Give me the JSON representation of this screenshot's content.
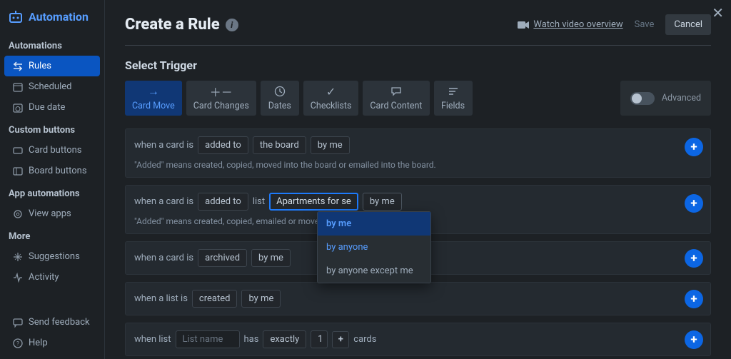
{
  "brand": "Automation",
  "sidebar": {
    "sections": [
      {
        "label": "Automations",
        "items": [
          {
            "label": "Rules",
            "active": true
          },
          {
            "label": "Scheduled"
          },
          {
            "label": "Due date"
          }
        ]
      },
      {
        "label": "Custom buttons",
        "items": [
          {
            "label": "Card buttons"
          },
          {
            "label": "Board buttons"
          }
        ]
      },
      {
        "label": "App automations",
        "items": [
          {
            "label": "View apps"
          }
        ]
      },
      {
        "label": "More",
        "items": [
          {
            "label": "Suggestions"
          },
          {
            "label": "Activity"
          }
        ]
      }
    ],
    "footer": [
      {
        "label": "Send feedback"
      },
      {
        "label": "Help"
      }
    ]
  },
  "header": {
    "title": "Create a Rule",
    "videoLink": "Watch video overview",
    "save": "Save",
    "cancel": "Cancel"
  },
  "section": {
    "title": "Select Trigger",
    "advanced": "Advanced"
  },
  "tabs": [
    {
      "label": "Card Move",
      "active": true
    },
    {
      "label": "Card Changes"
    },
    {
      "label": "Dates"
    },
    {
      "label": "Checklists"
    },
    {
      "label": "Card Content"
    },
    {
      "label": "Fields"
    }
  ],
  "rows": {
    "r1": {
      "t1": "when a card is",
      "p1": "added to",
      "p2": "the board",
      "p3": "by me",
      "hint": "\"Added\" means created, copied, moved into the board or emailed into the board."
    },
    "r2": {
      "t1": "when a card is",
      "p1": "added to",
      "t2": "list",
      "p2": "Apartments for se",
      "p3": "by me",
      "hint": "\"Added\" means created, copied, emailed or moved int",
      "dropdown": [
        "by me",
        "by anyone",
        "by anyone except me"
      ]
    },
    "r3": {
      "t1": "when a card is",
      "p1": "archived",
      "p2": "by me"
    },
    "r4": {
      "t1": "when a list is",
      "p1": "created",
      "p2": "by me"
    },
    "r5": {
      "t1": "when list",
      "placeholder": "List name",
      "t2": "has",
      "p1": "exactly",
      "num": "1",
      "t3": "cards"
    }
  }
}
